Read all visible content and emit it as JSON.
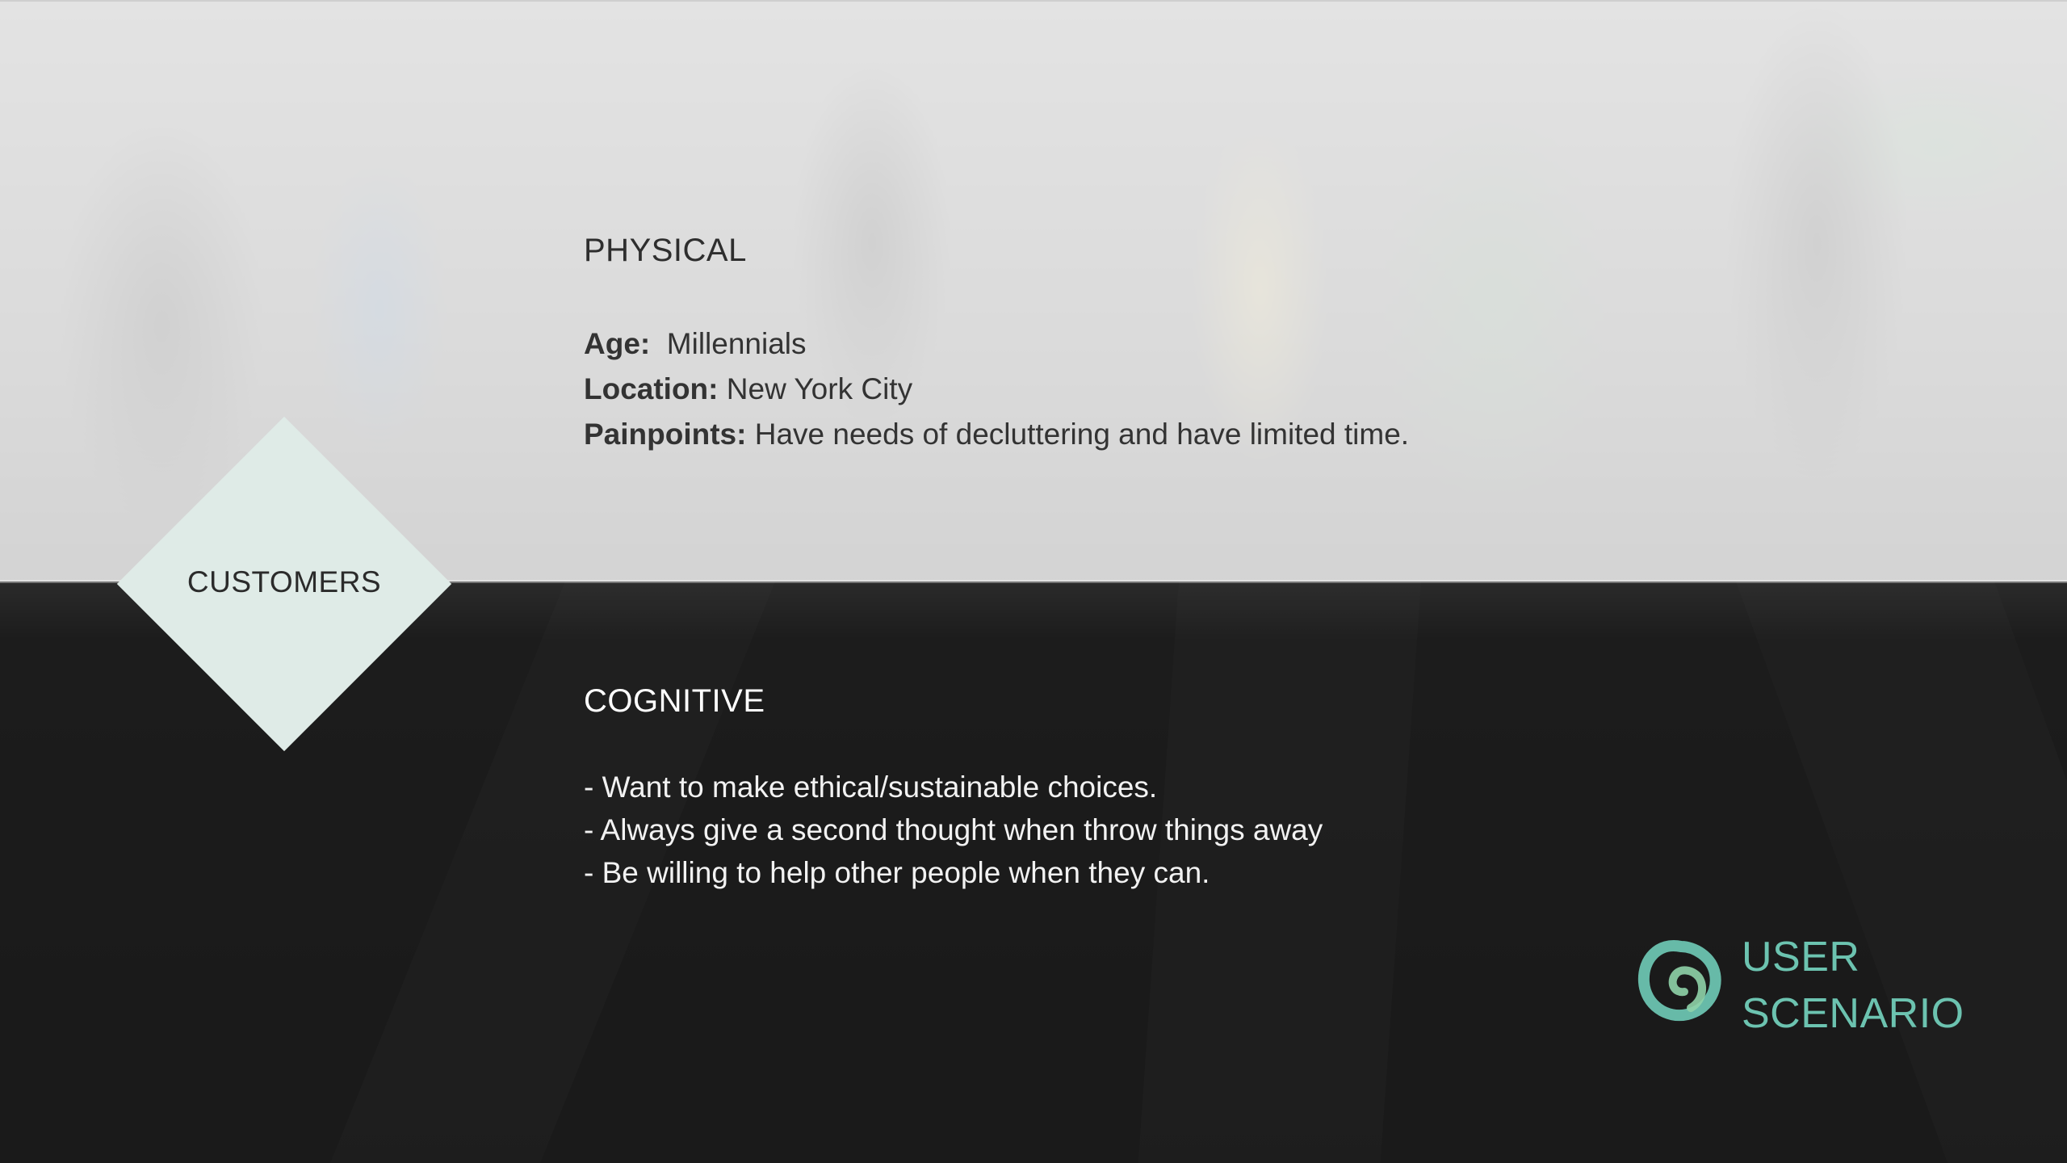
{
  "diamond": {
    "label": "CUSTOMERS",
    "color": "#dfebe7"
  },
  "physical": {
    "title": "PHYSICAL",
    "attributes": [
      {
        "key": "Age:",
        "value": "Millennials"
      },
      {
        "key": "Location:",
        "value": "New York City"
      },
      {
        "key": "Painpoints:",
        "value": "Have needs of decluttering and have limited time."
      }
    ]
  },
  "cognitive": {
    "title": "COGNITIVE",
    "bullets": [
      "- Want to make ethical/sustainable choices.",
      "- Always give a second thought when throw things away",
      "- Be willing to help other people when they can."
    ]
  },
  "brand": {
    "line1": "USER",
    "line2": "SCENARIO",
    "icon": "loop-logo-icon",
    "color": "#6cc3b0"
  }
}
